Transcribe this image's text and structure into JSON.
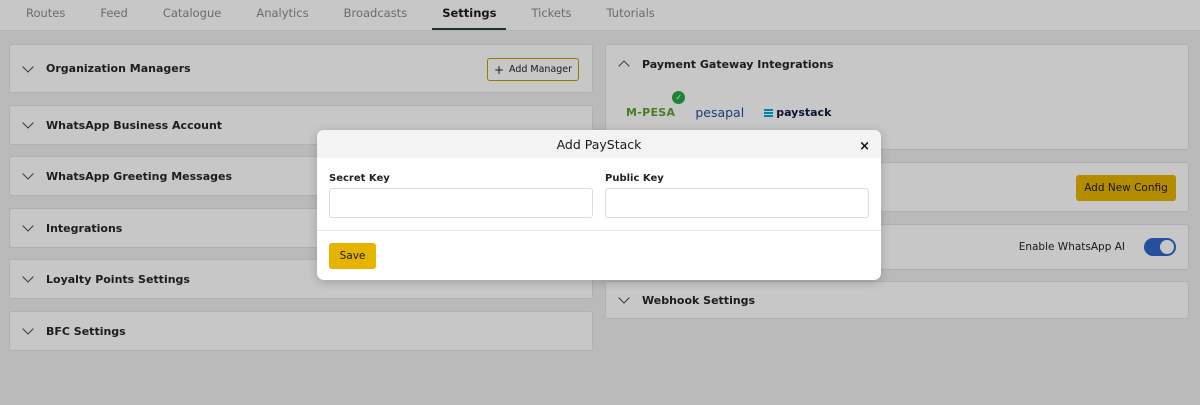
{
  "tabs": [
    "Routes",
    "Feed",
    "Catalogue",
    "Analytics",
    "Broadcasts",
    "Settings",
    "Tickets",
    "Tutorials"
  ],
  "active_tab": "Settings",
  "left_sections": {
    "org_managers": "Organization Managers",
    "add_manager": "Add Manager",
    "whatsapp_business": "WhatsApp Business Account",
    "greeting": "WhatsApp Greeting Messages",
    "integrations": "Integrations",
    "loyalty": "Loyalty Points Settings",
    "bfc": "BFC Settings"
  },
  "right_sections": {
    "payment_title": "Payment Gateway Integrations",
    "mpesa": "M-PESA",
    "pesapal": "pesapal",
    "paystack": "paystack",
    "add_new_config": "Add New Config",
    "enable_ai": "Enable WhatsApp AI",
    "ai_enabled": true,
    "webhook": "Webhook Settings"
  },
  "modal": {
    "title": "Add PayStack",
    "close": "×",
    "secret_label": "Secret Key",
    "secret_value": "",
    "public_label": "Public Key",
    "public_value": "",
    "save": "Save"
  },
  "colors": {
    "accent": "#e6b400",
    "tab_underline": "#24443f",
    "toggle": "#2f66c8"
  }
}
